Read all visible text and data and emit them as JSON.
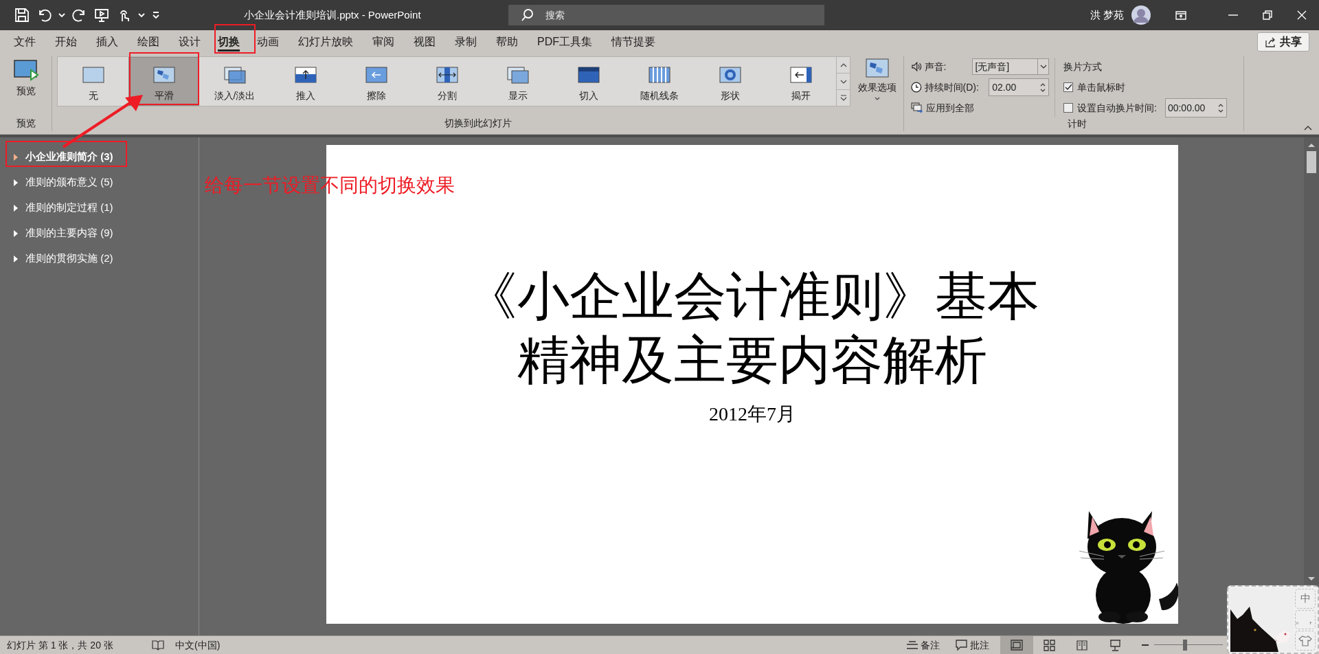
{
  "window": {
    "title": "小企业会计准则培训.pptx - PowerPoint"
  },
  "search": {
    "placeholder": "搜索"
  },
  "user": {
    "name": "洪 梦苑"
  },
  "menu_tabs": [
    {
      "label": "文件",
      "selected": false
    },
    {
      "label": "开始",
      "selected": false
    },
    {
      "label": "插入",
      "selected": false
    },
    {
      "label": "绘图",
      "selected": false
    },
    {
      "label": "设计",
      "selected": false
    },
    {
      "label": "切换",
      "selected": true
    },
    {
      "label": "动画",
      "selected": false
    },
    {
      "label": "幻灯片放映",
      "selected": false
    },
    {
      "label": "审阅",
      "selected": false
    },
    {
      "label": "视图",
      "selected": false
    },
    {
      "label": "录制",
      "selected": false
    },
    {
      "label": "帮助",
      "selected": false
    },
    {
      "label": "PDF工具集",
      "selected": false
    },
    {
      "label": "情节提要",
      "selected": false
    }
  ],
  "share_button": "共享",
  "ribbon": {
    "preview": {
      "button": "预览",
      "group_label": "预览"
    },
    "transitions": [
      {
        "label": "无",
        "selected": false
      },
      {
        "label": "平滑",
        "selected": true
      },
      {
        "label": "淡入/淡出",
        "selected": false
      },
      {
        "label": "推入",
        "selected": false
      },
      {
        "label": "擦除",
        "selected": false
      },
      {
        "label": "分割",
        "selected": false
      },
      {
        "label": "显示",
        "selected": false
      },
      {
        "label": "切入",
        "selected": false
      },
      {
        "label": "随机线条",
        "selected": false
      },
      {
        "label": "形状",
        "selected": false
      },
      {
        "label": "揭开",
        "selected": false
      }
    ],
    "effect_options": "效果选项",
    "transitions_group_label": "切换到此幻灯片",
    "timing": {
      "sound_label": "声音:",
      "sound_value": "[无声音]",
      "duration_label": "持续时间(D):",
      "duration_value": "02.00",
      "apply_all": "应用到全部",
      "advance_heading": "换片方式",
      "on_click": {
        "label": "单击鼠标时",
        "checked": true
      },
      "after": {
        "label": "设置自动换片时间:",
        "checked": false,
        "value": "00:00.00"
      },
      "group_label": "计时"
    }
  },
  "sections": [
    {
      "label": "小企业准则简介 (3)",
      "selected": true
    },
    {
      "label": "准则的颁布意义 (5)",
      "selected": false
    },
    {
      "label": "准则的制定过程 (1)",
      "selected": false
    },
    {
      "label": "准则的主要内容 (9)",
      "selected": false
    },
    {
      "label": "准则的贯彻实施 (2)",
      "selected": false
    }
  ],
  "annotation": "给每一节设置不同的切换效果",
  "slide": {
    "title_lines": [
      "《小企业会计准则》基本",
      "精神及主要内容解析"
    ],
    "subtitle": "2012年7月"
  },
  "status_bar": {
    "slide_info": "幻灯片 第 1 张，共 20 张",
    "language": "中文(中国)",
    "notes": "备注",
    "comments": "批注",
    "views": [
      {
        "selected": true
      },
      {
        "selected": false
      },
      {
        "selected": false
      },
      {
        "selected": false
      }
    ],
    "zoom": {
      "level": 0.45
    }
  },
  "ime": {
    "buttons": [
      "中",
      "。，"
    ]
  }
}
